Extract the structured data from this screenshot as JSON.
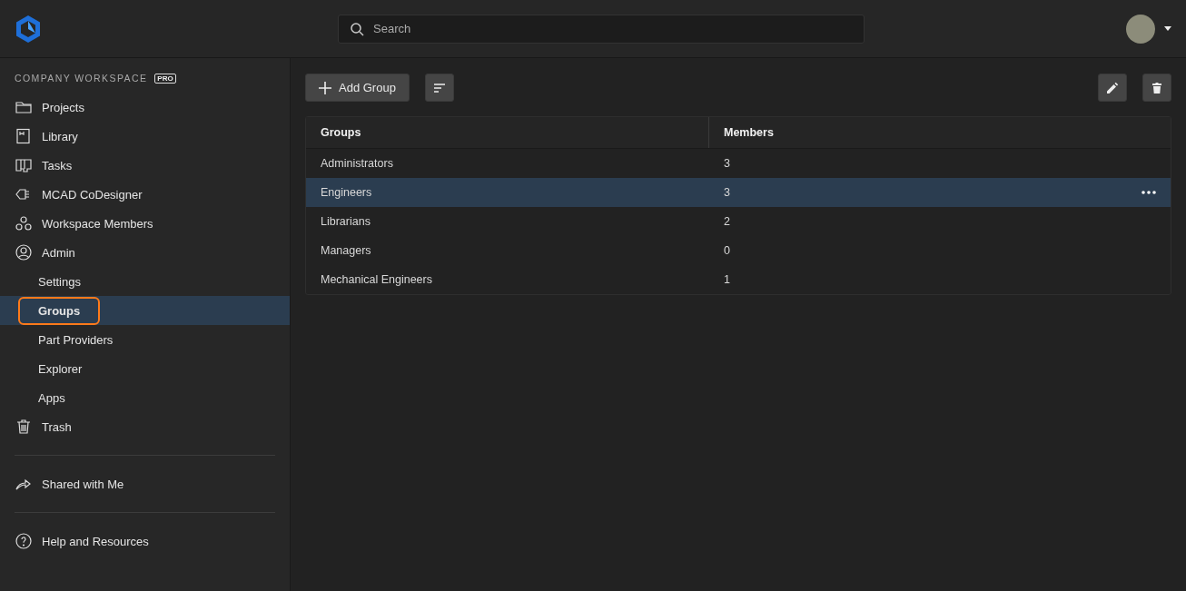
{
  "header": {
    "search": {
      "placeholder": "Search"
    }
  },
  "sidebar": {
    "workspace": "COMPANY WORKSPACE",
    "badge": "PRO",
    "sections": [
      [
        {
          "label": "Projects",
          "kind": "top",
          "selected": false,
          "highlighted": false
        },
        {
          "label": "Library",
          "kind": "top",
          "selected": false,
          "highlighted": false
        },
        {
          "label": "Tasks",
          "kind": "top",
          "selected": false,
          "highlighted": false
        },
        {
          "label": "MCAD CoDesigner",
          "kind": "top",
          "selected": false,
          "highlighted": false
        },
        {
          "label": "Workspace Members",
          "kind": "top",
          "selected": false,
          "highlighted": false
        },
        {
          "label": "Admin",
          "kind": "top",
          "selected": false,
          "highlighted": false
        },
        {
          "label": "Settings",
          "kind": "sub",
          "selected": false,
          "highlighted": false
        },
        {
          "label": "Groups",
          "kind": "sub",
          "selected": true,
          "highlighted": true
        },
        {
          "label": "Part Providers",
          "kind": "sub",
          "selected": false,
          "highlighted": false
        },
        {
          "label": "Explorer",
          "kind": "sub",
          "selected": false,
          "highlighted": false
        },
        {
          "label": "Apps",
          "kind": "sub",
          "selected": false,
          "highlighted": false
        },
        {
          "label": "Trash",
          "kind": "top",
          "selected": false,
          "highlighted": false
        }
      ],
      [
        {
          "label": "Shared with Me",
          "kind": "top",
          "selected": false,
          "highlighted": false
        }
      ],
      [
        {
          "label": "Help and Resources",
          "kind": "top",
          "selected": false,
          "highlighted": false
        }
      ]
    ]
  },
  "toolbar": {
    "add_button": "Add Group"
  },
  "table": {
    "columns": [
      "Groups",
      "Members"
    ],
    "rows": [
      {
        "cells": [
          "Administrators",
          "3"
        ],
        "selected": false
      },
      {
        "cells": [
          "Engineers",
          "3"
        ],
        "selected": true
      },
      {
        "cells": [
          "Librarians",
          "2"
        ],
        "selected": false
      },
      {
        "cells": [
          "Managers",
          "0"
        ],
        "selected": false
      },
      {
        "cells": [
          "Mechanical Engineers",
          "1"
        ],
        "selected": false
      }
    ]
  }
}
